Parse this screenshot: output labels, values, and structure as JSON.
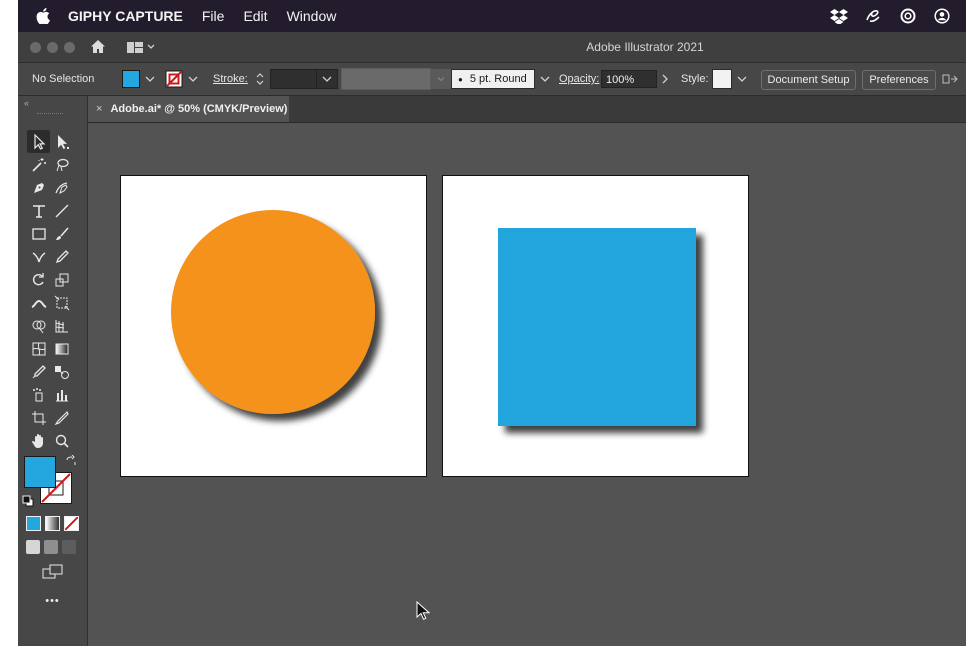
{
  "menubar": {
    "items": [
      "GIPHY CAPTURE",
      "File",
      "Edit",
      "Window"
    ],
    "icons": [
      "apple-icon",
      "dropbox-icon",
      "creative-cloud-script-icon",
      "creative-cloud-icon",
      "user-circle-icon"
    ]
  },
  "window": {
    "title": "Adobe Illustrator 2021"
  },
  "control_bar": {
    "selection": "No Selection",
    "stroke_label": "Stroke:",
    "brush_label": "5 pt. Round",
    "opacity_label": "Opacity:",
    "opacity_value": "100%",
    "style_label": "Style:",
    "document_setup": "Document Setup",
    "preferences": "Preferences"
  },
  "document": {
    "tab_title": "Adobe.ai* @ 50% (CMYK/Preview)",
    "tab_close": "×"
  },
  "toolbar": {
    "more_tools": "•••",
    "tools": [
      "selection",
      "direct-selection",
      "magic-wand",
      "lasso",
      "pen",
      "curvature",
      "type",
      "line-segment",
      "rectangle",
      "paintbrush",
      "shaper",
      "pencil",
      "rotate",
      "scale",
      "width",
      "free-transform",
      "shape-builder",
      "perspective-grid",
      "mesh",
      "gradient",
      "eyedropper",
      "blend",
      "symbol-sprayer",
      "column-graph",
      "artboard",
      "slice",
      "hand",
      "zoom"
    ]
  },
  "colors": {
    "fill": "#24a6df",
    "circle": "#f5921e",
    "square": "#21a4dd",
    "canvas": "#535353",
    "panel": "#474747"
  },
  "artwork": [
    "circle",
    "square"
  ]
}
